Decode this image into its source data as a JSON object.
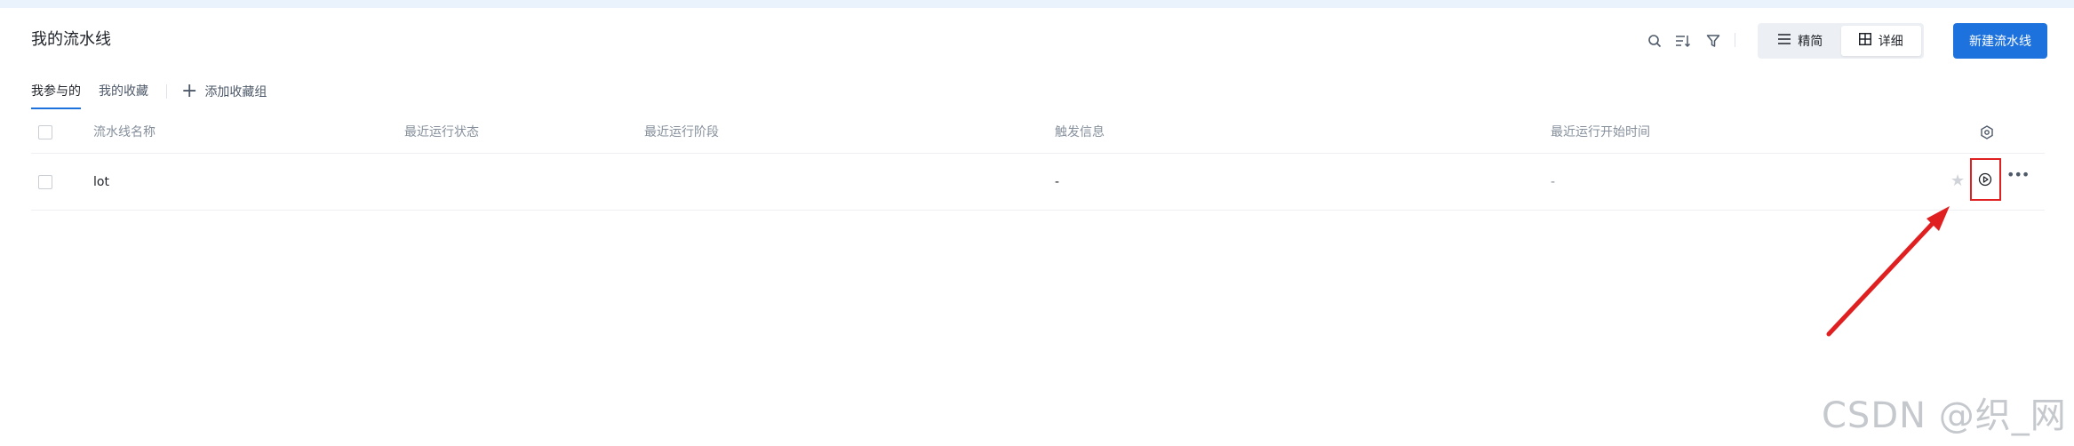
{
  "header": {
    "title": "我的流水线",
    "view_simple_label": "精简",
    "view_detail_label": "详细",
    "new_pipeline_label": "新建流水线"
  },
  "tabs": [
    {
      "label": "我参与的",
      "active": true
    },
    {
      "label": "我的收藏",
      "active": false
    }
  ],
  "add_group_label": "添加收藏组",
  "table": {
    "columns": [
      "流水线名称",
      "最近运行状态",
      "最近运行阶段",
      "触发信息",
      "最近运行开始时间"
    ],
    "rows": [
      {
        "name": "lot",
        "status": "",
        "stage": "",
        "trigger": "-",
        "start_time": "-"
      }
    ]
  },
  "watermark": "CSDN @织_网",
  "colors": {
    "primary": "#1e72dd",
    "annotation": "#e02020"
  }
}
